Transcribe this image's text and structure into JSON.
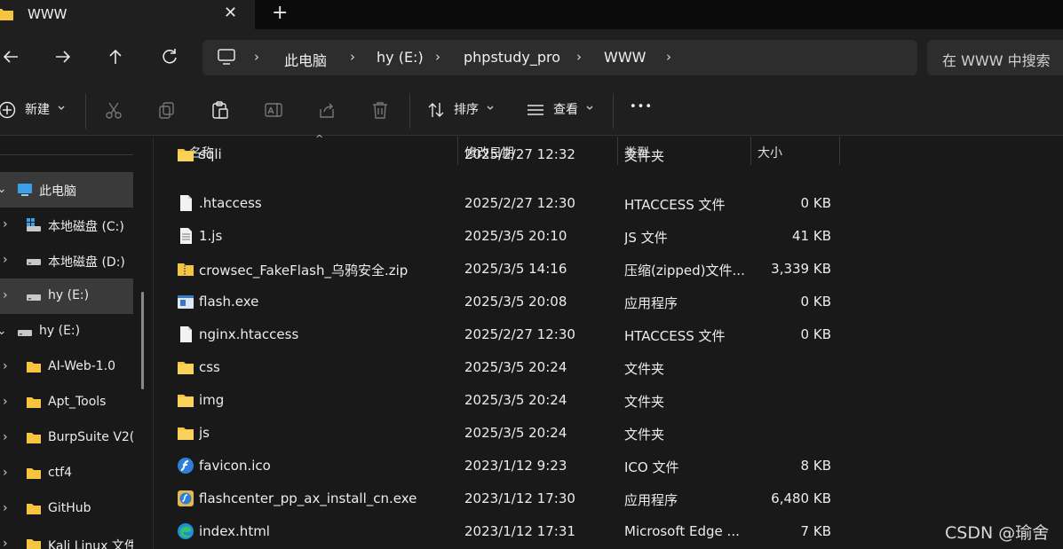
{
  "tab": {
    "title": "WWW",
    "close_glyph": "✕",
    "new_glyph": "+"
  },
  "nav": {
    "back": "←",
    "forward": "→",
    "up": "↑",
    "refresh": "↻",
    "breadcrumbs": [
      "此电脑",
      "hy (E:)",
      "phpstudy_pro",
      "WWW"
    ],
    "separator": "›",
    "search_placeholder": "在 WWW 中搜索"
  },
  "toolbar": {
    "new_label": "新建",
    "sort_label": "排序",
    "view_label": "查看",
    "more_label": "•••"
  },
  "sidebar": {
    "items": [
      {
        "label": "此电脑",
        "icon": "computer-icon",
        "chevron": "⌄"
      },
      {
        "label": "本地磁盘 (C:)",
        "icon": "drive-c-icon",
        "chevron": "›"
      },
      {
        "label": "本地磁盘 (D:)",
        "icon": "drive-icon",
        "chevron": "›"
      },
      {
        "label": "hy (E:)",
        "icon": "drive-icon",
        "chevron": "›"
      },
      {
        "label": "hy (E:)",
        "icon": "drive-icon",
        "chevron": "⌄"
      },
      {
        "label": "AI-Web-1.0",
        "icon": "folder-icon",
        "chevron": "›"
      },
      {
        "label": "Apt_Tools",
        "icon": "folder-icon",
        "chevron": "›"
      },
      {
        "label": "BurpSuite V2(",
        "icon": "folder-icon",
        "chevron": "›"
      },
      {
        "label": "ctf4",
        "icon": "folder-icon",
        "chevron": "›"
      },
      {
        "label": "GitHub",
        "icon": "folder-icon",
        "chevron": "›"
      },
      {
        "label": "Kali Linux 文件",
        "icon": "folder-icon",
        "chevron": "›"
      }
    ]
  },
  "columns": {
    "name": "名称",
    "date": "修改日期",
    "type": "类型",
    "size": "大小",
    "sort_caret": "^"
  },
  "files": [
    {
      "name": "sqli",
      "date": "2025/2/27 12:32",
      "type": "文件夹",
      "size": "",
      "icon": "folder-icon"
    },
    {
      "name": ".htaccess",
      "date": "2025/2/27 12:30",
      "type": "HTACCESS 文件",
      "size": "0 KB",
      "icon": "file-icon"
    },
    {
      "name": "1.js",
      "date": "2025/3/5 20:10",
      "type": "JS 文件",
      "size": "41 KB",
      "icon": "text-file-icon"
    },
    {
      "name": "crowsec_FakeFlash_乌鸦安全.zip",
      "date": "2025/3/5 14:16",
      "type": "压缩(zipped)文件...",
      "size": "3,339 KB",
      "icon": "zip-folder-icon"
    },
    {
      "name": "flash.exe",
      "date": "2025/3/5 20:08",
      "type": "应用程序",
      "size": "0 KB",
      "icon": "exe-icon"
    },
    {
      "name": "nginx.htaccess",
      "date": "2025/2/27 12:30",
      "type": "HTACCESS 文件",
      "size": "0 KB",
      "icon": "file-icon"
    },
    {
      "name": "css",
      "date": "2025/3/5 20:24",
      "type": "文件夹",
      "size": "",
      "icon": "folder-icon"
    },
    {
      "name": "img",
      "date": "2025/3/5 20:24",
      "type": "文件夹",
      "size": "",
      "icon": "folder-icon"
    },
    {
      "name": "js",
      "date": "2025/3/5 20:24",
      "type": "文件夹",
      "size": "",
      "icon": "folder-icon"
    },
    {
      "name": "favicon.ico",
      "date": "2023/1/12 9:23",
      "type": "ICO 文件",
      "size": "8 KB",
      "icon": "flash-icon"
    },
    {
      "name": "flashcenter_pp_ax_install_cn.exe",
      "date": "2023/1/12 17:30",
      "type": "应用程序",
      "size": "6,480 KB",
      "icon": "flash-installer-icon"
    },
    {
      "name": "index.html",
      "date": "2023/1/12 17:31",
      "type": "Microsoft Edge ...",
      "size": "7 KB",
      "icon": "edge-icon"
    }
  ],
  "watermark": "CSDN @瑜舍",
  "colors": {
    "folder": "#f5c542",
    "accent": "#4aa3ff",
    "selected": "#3a3a3a"
  }
}
